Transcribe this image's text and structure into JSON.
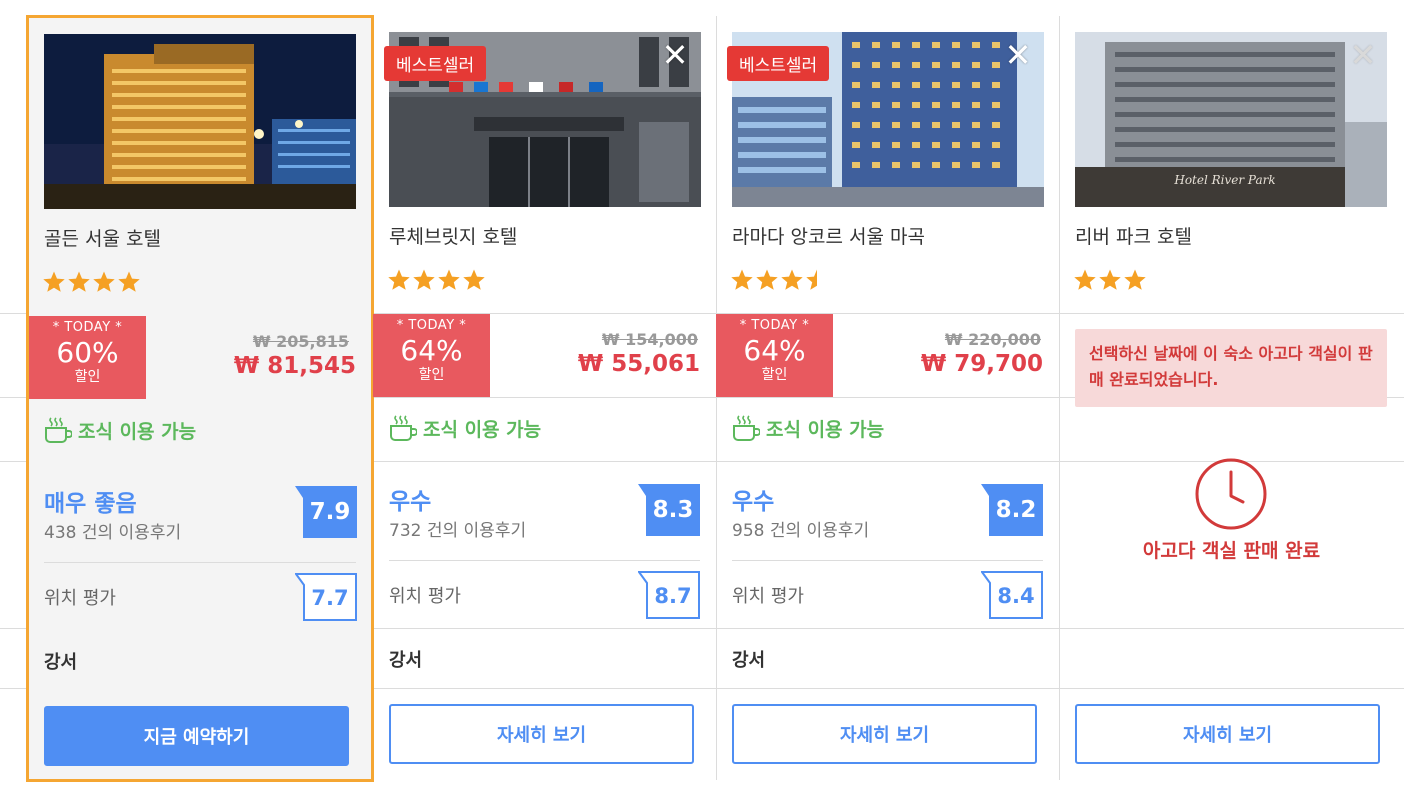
{
  "hotels": [
    {
      "name": "골든 서울 호텔",
      "best_seller": "",
      "star_count": 4,
      "half_star": false,
      "today_label": "* TODAY *",
      "discount_pct": "60%",
      "discount_word": "할인",
      "price_original": "₩ 205,815",
      "price_sale": "₩ 81,545",
      "breakfast": "조식 이용 가능",
      "review_word": "매우 좋음",
      "review_count": "438 건의 이용후기",
      "review_score": "7.9",
      "location_label": "위치 평가",
      "location_score": "7.7",
      "area": "강서",
      "button": "지금 예약하기"
    },
    {
      "name": "루체브릿지 호텔",
      "best_seller": "베스트셀러",
      "star_count": 4,
      "half_star": false,
      "today_label": "* TODAY *",
      "discount_pct": "64%",
      "discount_word": "할인",
      "price_original": "₩ 154,000",
      "price_sale": "₩ 55,061",
      "breakfast": "조식 이용 가능",
      "review_word": "우수",
      "review_count": "732 건의 이용후기",
      "review_score": "8.3",
      "location_label": "위치 평가",
      "location_score": "8.7",
      "area": "강서",
      "button": "자세히 보기"
    },
    {
      "name": "라마다 앙코르 서울 마곡",
      "best_seller": "베스트셀러",
      "star_count": 3,
      "half_star": true,
      "today_label": "* TODAY *",
      "discount_pct": "64%",
      "discount_word": "할인",
      "price_original": "₩ 220,000",
      "price_sale": "₩ 79,700",
      "breakfast": "조식 이용 가능",
      "review_word": "우수",
      "review_count": "958 건의 이용후기",
      "review_score": "8.2",
      "location_label": "위치 평가",
      "location_score": "8.4",
      "area": "강서",
      "button": "자세히 보기"
    },
    {
      "name": "리버 파크 호텔",
      "best_seller": "",
      "star_count": 3,
      "half_star": false,
      "soldout_message": "선택하신 날짜에 이 숙소 아고다 객실이 판매 완료되었습니다.",
      "soldout_label": "아고다 객실 판매 완료",
      "button": "자세히 보기"
    }
  ],
  "colors": {
    "accent_blue": "#4f8ef3",
    "discount_red": "#e8595f",
    "best_seller_red": "#e53935",
    "breakfast_green": "#5cb85c",
    "selected_border": "#f5a632",
    "star_orange": "#f5a023"
  }
}
